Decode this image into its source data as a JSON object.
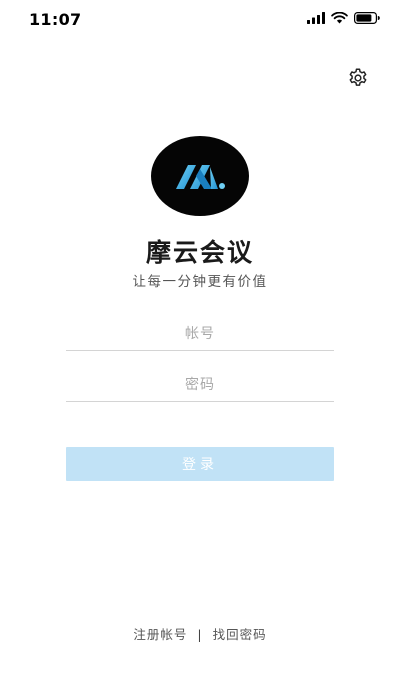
{
  "status_bar": {
    "time": "11:07",
    "icons": [
      "signal-icon",
      "wifi-icon",
      "battery-icon"
    ]
  },
  "header": {
    "settings_icon": "gear-icon"
  },
  "brand": {
    "logo_icon": "app-logo-m",
    "logo_bg_color": "#050505",
    "logo_accent_color": "#2ba6e0",
    "title": "摩云会议",
    "slogan": "让每一分钟更有价值"
  },
  "form": {
    "account_placeholder": "帐号",
    "account_value": "",
    "password_placeholder": "密码",
    "password_value": "",
    "login_label": "登录",
    "login_color": "#c1e2f6"
  },
  "footer": {
    "register_label": "注册帐号",
    "separator": "|",
    "recover_label": "找回密码"
  }
}
